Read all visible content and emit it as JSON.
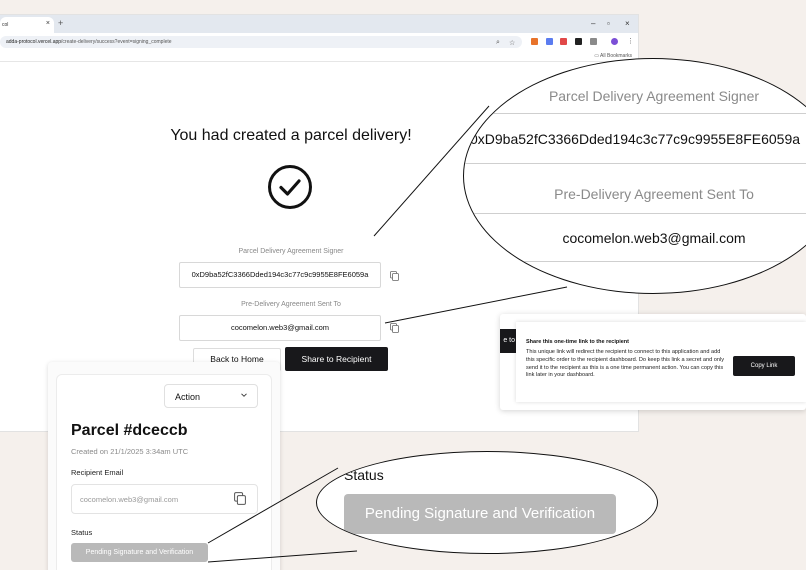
{
  "browser": {
    "tab_title": "col",
    "tab_close": "×",
    "new_tab": "+",
    "url_host": "adda-protocol.vercel.app",
    "url_path": "/create-delivery/success?event=signing_complete",
    "all_bookmarks": "All Bookmarks",
    "window_controls": [
      "–",
      "▫",
      "×"
    ],
    "extension_colors": [
      "#e8732a",
      "#5b7cf0",
      "#e14848",
      "#222222",
      "#8a8a8a",
      "#7b4fd6"
    ]
  },
  "page": {
    "headline": "You had created a parcel delivery!",
    "signer_label": "Parcel Delivery Agreement Signer",
    "signer_value": "0xD9ba52fC3366Dded194c3c77c9c9955E8FE6059a",
    "sent_to_label": "Pre-Delivery Agreement Sent To",
    "sent_to_value": "cocomelon.web3@gmail.com",
    "back_home": "Back to Home",
    "share_recipient": "Share to Recipient"
  },
  "zoom_top": {
    "signer_label": "Parcel Delivery Agreement Signer",
    "signer_value": "0xD9ba52fC3366Dded194c3c77c9c9955E8FE6059a",
    "sent_to_label": "Pre-Delivery Agreement Sent To",
    "sent_to_value": "cocomelon.web3@gmail.com"
  },
  "share_dialog": {
    "edge_text": "e to",
    "title": "Share this one-time link to the recipient",
    "body": "This unique link will redirect the recipient to connect to this application and add this specific order to the recipient dashboard. Do keep this link a secret and only send it to the recipient as this is a one time permanent action. You can copy this link later in your dashboard.",
    "copy_link": "Copy Link"
  },
  "parcel_card": {
    "action": "Action",
    "title": "Parcel #dceccb",
    "created": "Created on 21/1/2025 3:34am UTC",
    "recipient_label": "Recipient Email",
    "recipient_value": "cocomelon.web3@gmail.com",
    "status_label": "Status",
    "status_value": "Pending Signature and Verification"
  },
  "zoom_status": {
    "status_label": "Status",
    "status_value": "Pending Signature and Verification"
  },
  "colors": {
    "primary_button": "#18181b",
    "status_pill": "#b9b9b9",
    "background": "#f5f0ec"
  }
}
